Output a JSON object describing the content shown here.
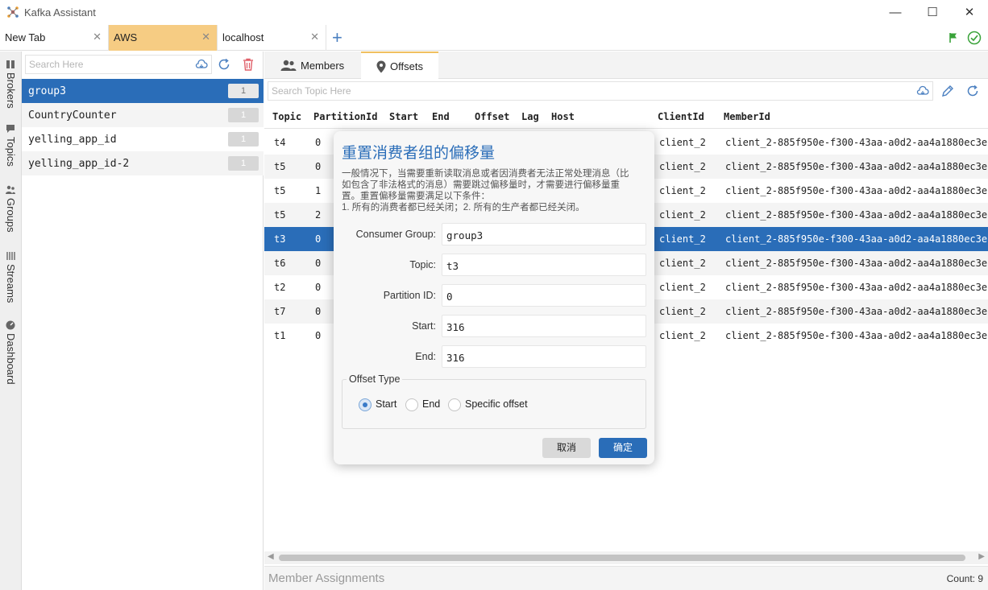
{
  "window": {
    "title": "Kafka Assistant",
    "minimize": "—",
    "maximize": "☐",
    "close": "✕"
  },
  "tabs": [
    {
      "label": "New Tab",
      "close": "✕"
    },
    {
      "label": "AWS",
      "close": "✕"
    },
    {
      "label": "localhost",
      "close": "✕"
    }
  ],
  "tab_add": "+",
  "side_nav": [
    "Brokers",
    "Topics",
    "Groups",
    "Streams",
    "Dashboard"
  ],
  "groups_panel": {
    "search_placeholder": "Search Here",
    "items": [
      {
        "name": "group3",
        "count": "1",
        "selected": true
      },
      {
        "name": "CountryCounter",
        "count": "1"
      },
      {
        "name": "yelling_app_id",
        "count": "1"
      },
      {
        "name": "yelling_app_id-2",
        "count": "1"
      }
    ]
  },
  "main": {
    "tabs": [
      {
        "label": "Members"
      },
      {
        "label": "Offsets"
      }
    ],
    "topic_search_placeholder": "Search Topic Here",
    "columns": [
      "Topic",
      "PartitionId",
      "Start",
      "End",
      "Offset",
      "Lag",
      "Host",
      "ClientId",
      "MemberId"
    ],
    "rows": [
      {
        "topic": "t4",
        "partition": "0",
        "client": "client_2",
        "member": "client_2-885f950e-f300-43aa-a0d2-aa4a1880ec3e"
      },
      {
        "topic": "t5",
        "partition": "0",
        "client": "client_2",
        "member": "client_2-885f950e-f300-43aa-a0d2-aa4a1880ec3e"
      },
      {
        "topic": "t5",
        "partition": "1",
        "client": "client_2",
        "member": "client_2-885f950e-f300-43aa-a0d2-aa4a1880ec3e"
      },
      {
        "topic": "t5",
        "partition": "2",
        "client": "client_2",
        "member": "client_2-885f950e-f300-43aa-a0d2-aa4a1880ec3e"
      },
      {
        "topic": "t3",
        "partition": "0",
        "client": "client_2",
        "member": "client_2-885f950e-f300-43aa-a0d2-aa4a1880ec3e",
        "selected": true
      },
      {
        "topic": "t6",
        "partition": "0",
        "client": "client_2",
        "member": "client_2-885f950e-f300-43aa-a0d2-aa4a1880ec3e"
      },
      {
        "topic": "t2",
        "partition": "0",
        "client": "client_2",
        "member": "client_2-885f950e-f300-43aa-a0d2-aa4a1880ec3e"
      },
      {
        "topic": "t7",
        "partition": "0",
        "client": "client_2",
        "member": "client_2-885f950e-f300-43aa-a0d2-aa4a1880ec3e"
      },
      {
        "topic": "t1",
        "partition": "0",
        "client": "client_2",
        "member": "client_2-885f950e-f300-43aa-a0d2-aa4a1880ec3e"
      }
    ],
    "status_title": "Member Assignments",
    "status_count": "Count: 9"
  },
  "dialog": {
    "title": "重置消费者组的偏移量",
    "desc_lines": [
      "一般情况下，当需要重新读取消息或者因消费者无法正常处理消息（比",
      "如包含了非法格式的消息）需要跳过偏移量时，才需要进行偏移量重",
      "置。重置偏移量需要满足以下条件：",
      "1. 所有的消费者都已经关闭；2. 所有的生产者都已经关闭。"
    ],
    "fields": {
      "consumer_group": {
        "label": "Consumer Group:",
        "value": "group3"
      },
      "topic": {
        "label": "Topic:",
        "value": "t3"
      },
      "partition": {
        "label": "Partition ID:",
        "value": "0"
      },
      "start": {
        "label": "Start:",
        "value": "316"
      },
      "end": {
        "label": "End:",
        "value": "316"
      }
    },
    "offset_type": {
      "legend": "Offset Type",
      "options": [
        "Start",
        "End",
        "Specific offset"
      ],
      "selected": "Start"
    },
    "cancel_label": "取消",
    "ok_label": "确定"
  },
  "colors": {
    "accent": "#2a6db8",
    "active_tab": "#f6cc83",
    "status_ok": "#3aa33a"
  }
}
